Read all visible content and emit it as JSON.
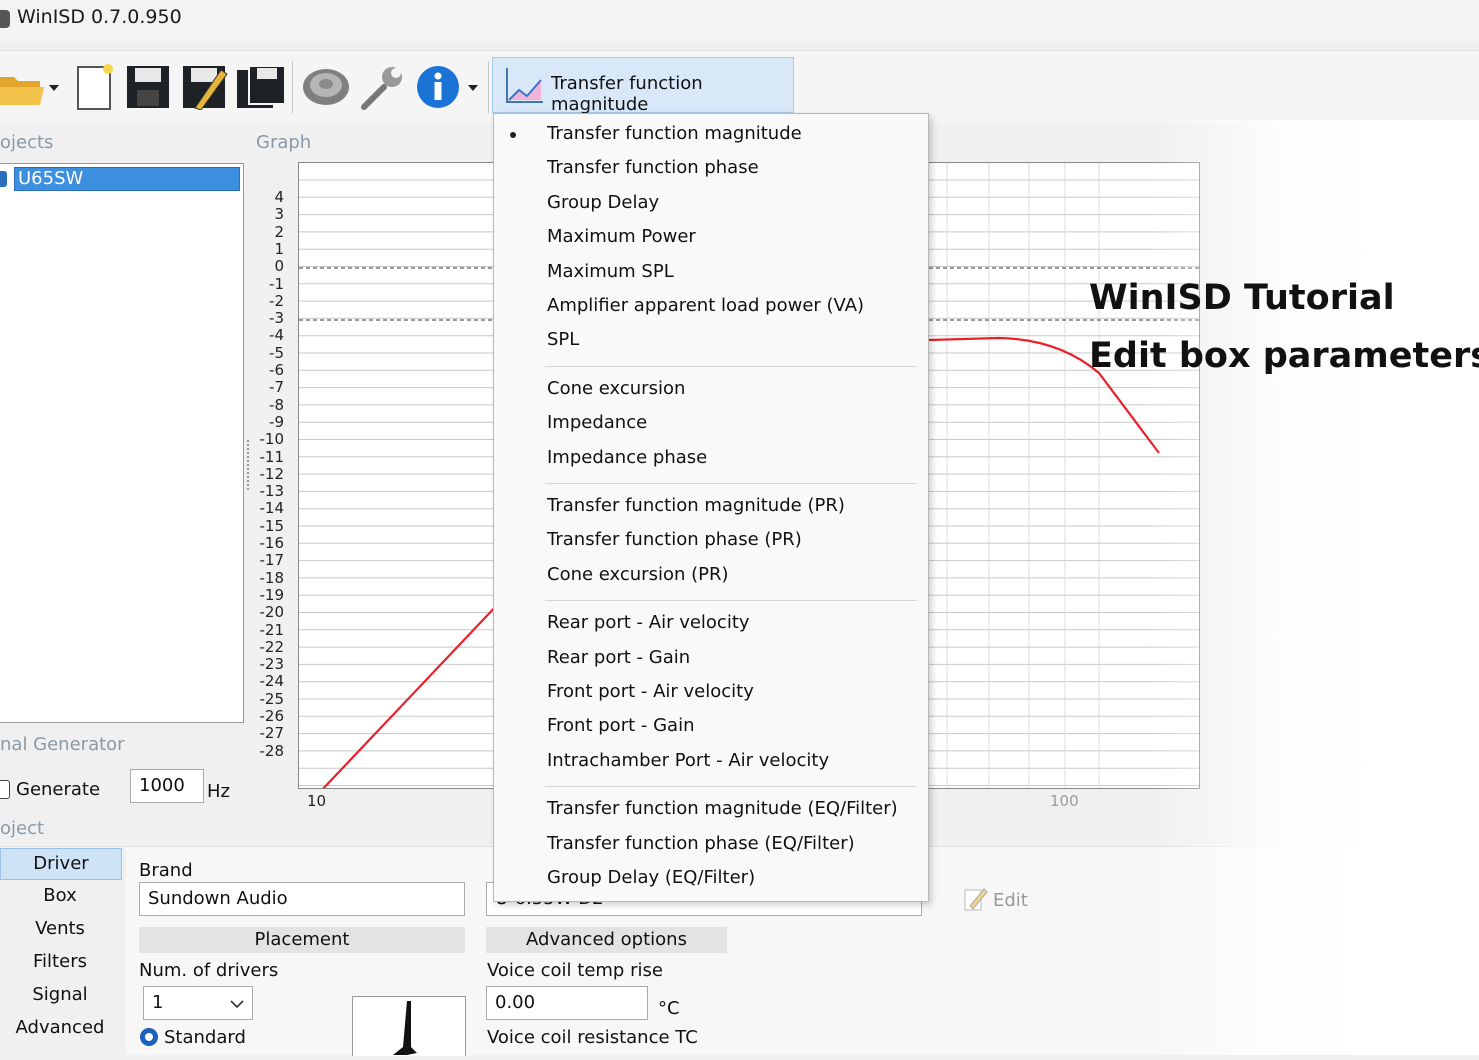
{
  "window": {
    "title": "WinISD 0.7.0.950"
  },
  "toolbar": {
    "open_icon": "folder-open-icon",
    "new_icon": "new-document-icon",
    "save_icon": "save-icon",
    "edit_icon": "pencil-icon",
    "save_all_icon": "save-all-icon",
    "driver_icon": "speaker-driver-icon",
    "tools_icon": "wrench-icon",
    "info_icon": "info-icon",
    "graph_dropdown_label": "Transfer function magnitude"
  },
  "panels": {
    "projects_label": "ojects",
    "graph_label": "Graph",
    "signal_generator_label": "nal Generator",
    "project_label": "oject"
  },
  "projects": {
    "items": [
      "U65SW"
    ]
  },
  "graph": {
    "y_ticks": [
      "4",
      "3",
      "2",
      "1",
      "0",
      "-1",
      "-2",
      "-3",
      "-4",
      "-5",
      "-6",
      "-7",
      "-8",
      "-9",
      "-10",
      "-11",
      "-12",
      "-13",
      "-14",
      "-15",
      "-16",
      "-17",
      "-18",
      "-19",
      "-20",
      "-21",
      "-22",
      "-23",
      "-24",
      "-25",
      "-26",
      "-27",
      "-28"
    ],
    "x_ticks": [
      "10",
      "100"
    ]
  },
  "graph_menu": {
    "selected": "Transfer function magnitude",
    "groups": [
      [
        "Transfer function magnitude",
        "Transfer function phase",
        "Group Delay",
        "Maximum Power",
        "Maximum SPL",
        "Amplifier apparent load power (VA)",
        "SPL"
      ],
      [
        "Cone excursion",
        "Impedance",
        "Impedance phase"
      ],
      [
        "Transfer function magnitude (PR)",
        "Transfer function phase (PR)",
        "Cone excursion (PR)"
      ],
      [
        "Rear port - Air velocity",
        "Rear port - Gain",
        "Front port - Air velocity",
        "Front port - Gain",
        "Intrachamber Port - Air velocity"
      ],
      [
        "Transfer function magnitude (EQ/Filter)",
        "Transfer function phase (EQ/Filter)",
        "Group Delay (EQ/Filter)"
      ]
    ]
  },
  "overlay": {
    "line1": "WinISD Tutorial",
    "line2": "Edit box parameters"
  },
  "signal_generator": {
    "generate_label": "Generate",
    "frequency": "1000",
    "unit": "Hz"
  },
  "project_tabs": [
    "Driver",
    "Box",
    "Vents",
    "Filters",
    "Signal",
    "Advanced"
  ],
  "driver": {
    "brand_label": "Brand",
    "brand_value": "Sundown Audio",
    "model_partial": "U-6.55W-D2",
    "edit_label": "Edit",
    "placement_header": "Placement",
    "num_drivers_label": "Num. of drivers",
    "num_drivers_value": "1",
    "standard_label": "Standard",
    "advanced_header": "Advanced options",
    "vc_temp_label": "Voice coil temp rise",
    "vc_temp_value": "0.00",
    "vc_temp_unit": "°C",
    "vc_resistance_label": "Voice coil resistance TC"
  },
  "colors": {
    "accent": "#3d8fe0",
    "curve": "#e8202a",
    "menu_bg": "#f9f9f9"
  }
}
